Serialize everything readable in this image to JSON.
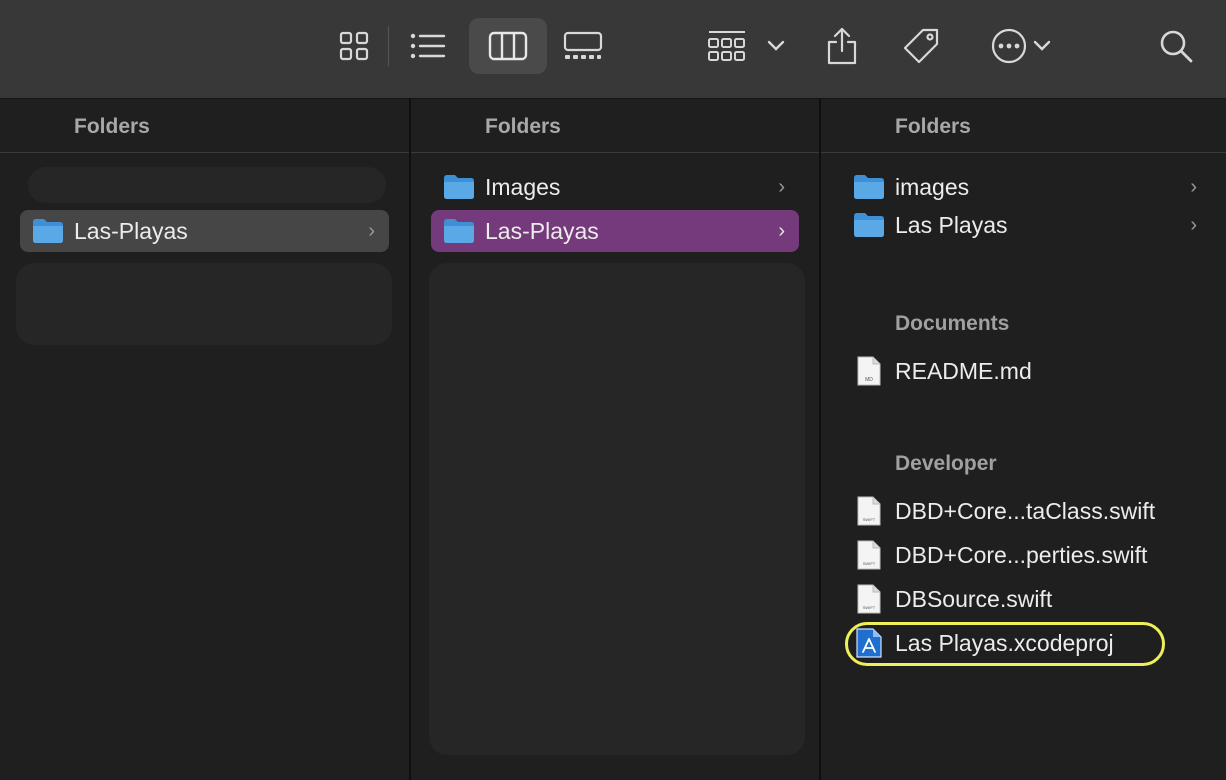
{
  "toolbar": {
    "buttons": [
      {
        "icon": "icon-view-grid-icon"
      },
      {
        "icon": "list-view-icon"
      },
      {
        "icon": "column-view-icon",
        "active": true
      },
      {
        "icon": "gallery-view-icon"
      },
      {
        "icon": "group-by-icon"
      },
      {
        "icon": "share-icon"
      },
      {
        "icon": "tag-icon"
      },
      {
        "icon": "more-actions-icon"
      },
      {
        "icon": "search-icon"
      }
    ]
  },
  "columns": [
    {
      "header": "Folders",
      "items": [
        {
          "label": "Las-Playas",
          "type": "folder",
          "selected": "inactive"
        }
      ]
    },
    {
      "header": "Folders",
      "items": [
        {
          "label": "Images",
          "type": "folder"
        },
        {
          "label": "Las-Playas",
          "type": "folder",
          "selected": "active"
        }
      ]
    },
    {
      "header": "Folders",
      "items": [
        {
          "label": "images",
          "type": "folder"
        },
        {
          "label": "Las Playas",
          "type": "folder"
        }
      ],
      "documents_title": "Documents",
      "documents": [
        {
          "label": "README.md",
          "badge": "MD"
        }
      ],
      "developer_title": "Developer",
      "developer": [
        {
          "label": "DBD+Core...taClass.swift",
          "badge": "SWIFT"
        },
        {
          "label": "DBD+Core...perties.swift",
          "badge": "SWIFT"
        },
        {
          "label": "DBSource.swift",
          "badge": "SWIFT"
        },
        {
          "label": "Las Playas.xcodeproj",
          "badge": "",
          "highlighted": true
        }
      ]
    }
  ],
  "colors": {
    "selection_active": "#753a7b",
    "selection_inactive": "#464646",
    "highlight": "#eef05a",
    "folder": "#5aa9e6"
  }
}
